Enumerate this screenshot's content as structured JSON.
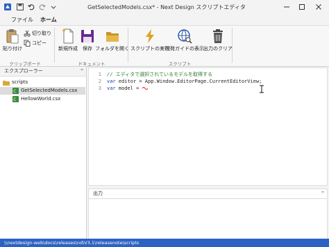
{
  "window": {
    "title": "GetSelectedModels.csx* - Next Design スクリプトエディタ"
  },
  "ribbon": {
    "tabs": [
      {
        "label": "ファイル"
      },
      {
        "label": "ホーム"
      }
    ],
    "clipboard": {
      "paste_label": "貼り付け",
      "cut_label": "切り取り",
      "copy_label": "コピー",
      "group_label": "クリップボード"
    },
    "document": {
      "new_label": "新規作成",
      "save_label": "保存",
      "open_folder_label": "フォルダを開く",
      "group_label": "ドキュメント"
    },
    "script": {
      "run_label": "スクリプトの実行",
      "devguide_label": "開発ガイドの表示",
      "clear_output_label": "出力のクリア",
      "group_label": "スクリプト"
    }
  },
  "explorer": {
    "title": "エクスプローラー",
    "pin": "ꟸ",
    "items": [
      {
        "label": "scripts",
        "icon": "folder-icon"
      },
      {
        "label": "GetSelectedModels.csx",
        "icon": "csharp-file-icon"
      },
      {
        "label": "HellowWorld.csx",
        "icon": "csharp-file-icon"
      }
    ]
  },
  "editor": {
    "line_numbers": [
      "1",
      "2",
      "3"
    ],
    "lines": [
      {
        "text": "// エディタで選択されているモデルを取得する"
      },
      {
        "kw": "var",
        "text": " editor = App.Window.EditorPage.CurrentEditorView;"
      },
      {
        "kw": "var",
        "text": " model = "
      }
    ]
  },
  "output": {
    "title": "出力",
    "pin": "ꟸ"
  },
  "status": {
    "path": "\\\\nextdesign-web\\docs\\releases\\nd\\V3.1\\releasenote\\scripts"
  },
  "colors": {
    "accent": "#2b62c4",
    "save": "#6b2a8e",
    "folder": "#c9962a",
    "run": "#e0a21c"
  }
}
